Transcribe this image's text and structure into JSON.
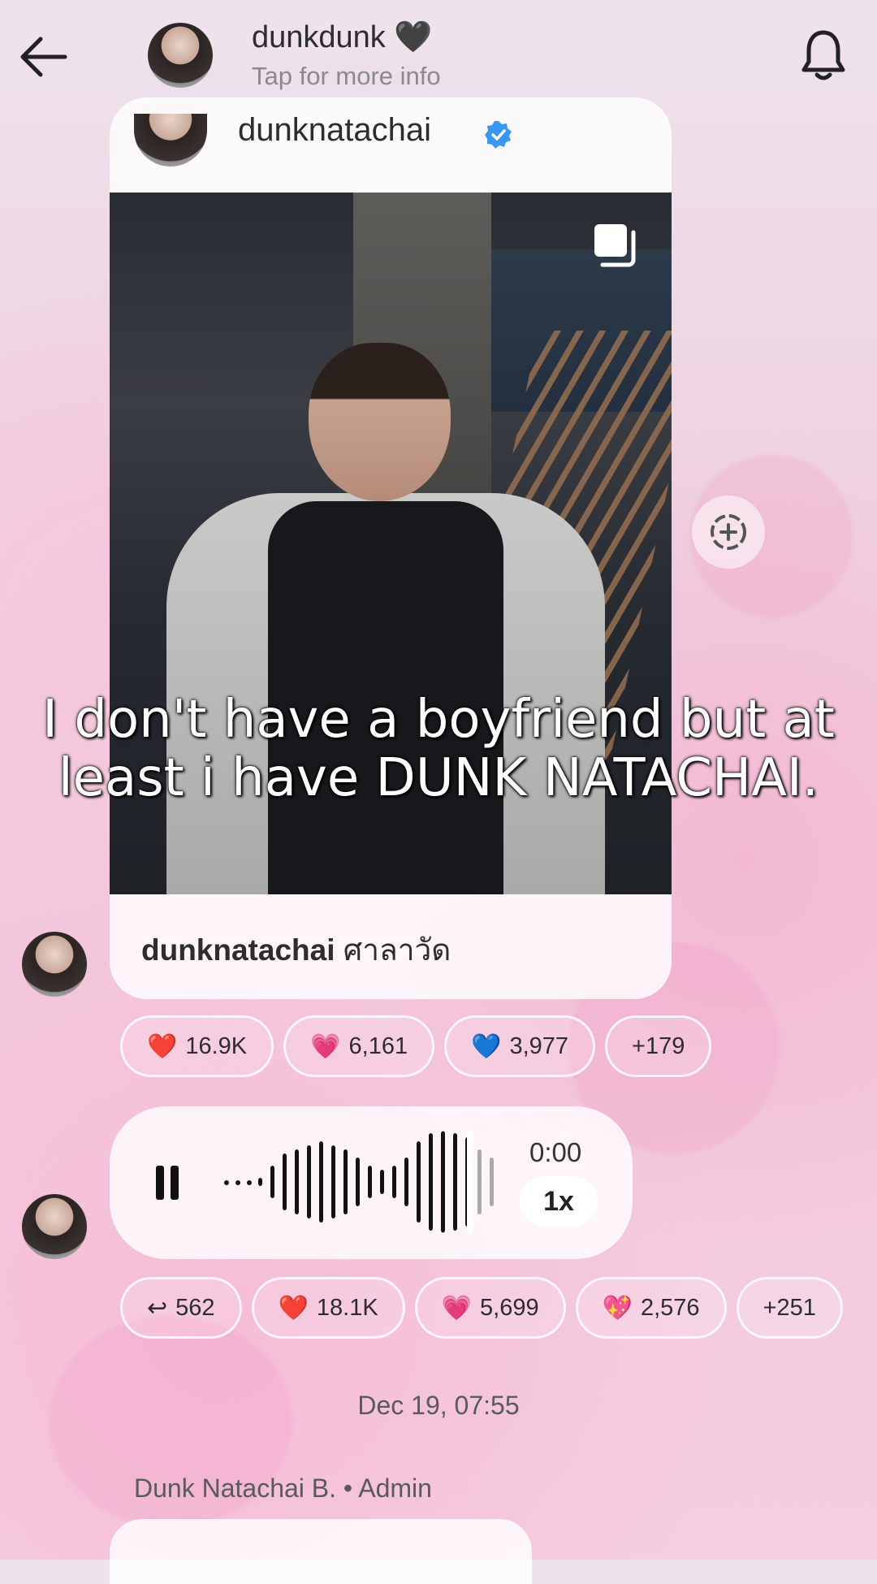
{
  "header": {
    "title": "dunkdunk 🖤",
    "subtitle": "Tap for more info"
  },
  "post": {
    "username": "dunknatachai",
    "overlay_caption": "I don't have a boyfriend but at least i have DUNK NATACHAI.",
    "caption_user": "dunknatachai",
    "caption_text": "ศาลาวัด"
  },
  "post_reactions": [
    {
      "emoji": "❤️",
      "count": "16.9K"
    },
    {
      "emoji": "💗",
      "count": "6,161"
    },
    {
      "emoji": "💙",
      "count": "3,977"
    },
    {
      "emoji": "",
      "count": "+179"
    }
  ],
  "voice": {
    "time": "0:00",
    "speed": "1x"
  },
  "voice_reactions": [
    {
      "emoji": "↩",
      "count": "562"
    },
    {
      "emoji": "❤️",
      "count": "18.1K"
    },
    {
      "emoji": "💗",
      "count": "5,699"
    },
    {
      "emoji": "💖",
      "count": "2,576"
    },
    {
      "emoji": "",
      "count": "+251"
    }
  ],
  "timestamp": "Dec 19, 07:55",
  "sender": "Dunk Natachai B. • Admin",
  "colors": {
    "verified": "#3897f0",
    "card": "#ffffff",
    "background": "#f2c9dc"
  },
  "icons": [
    "back-arrow-icon",
    "bell-icon",
    "verified-icon",
    "multiple-images-icon",
    "add-icon",
    "pause-icon"
  ]
}
